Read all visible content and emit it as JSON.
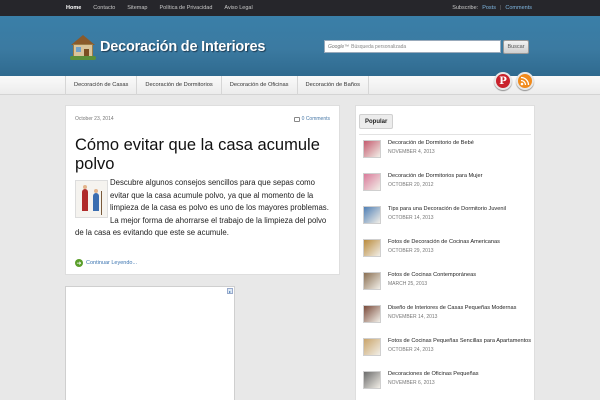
{
  "topbar": {
    "nav": [
      "Home",
      "Contacto",
      "Sitemap",
      "Política de Privacidad",
      "Aviso Legal"
    ],
    "subscribe_label": "Subscribe:",
    "subscribe_posts": "Posts",
    "subscribe_sep": "|",
    "subscribe_comments": "Comments"
  },
  "header": {
    "site_title": "Decoración de Interiores",
    "search_brand": "Google™",
    "search_placeholder": "Búsqueda personalizada",
    "search_button": "Buscar"
  },
  "categories": [
    "Decoración de Casas",
    "Decoración de Dormitorios",
    "Decoración de Oficinas",
    "Decoración de Baños"
  ],
  "social": {
    "pinterest_icon": "pinterest-icon",
    "rss_icon": "rss-icon"
  },
  "post": {
    "date": "October 23, 2014",
    "comments": "0 Comments",
    "title": "Cómo evitar que la casa acumule polvo",
    "excerpt": "Descubre algunos consejos sencillos para que sepas como evitar que la casa acumule polvo, ya que al momento de la limpieza de la casa es polvo es uno de los mayores problemas. La mejor forma de ahorrarse el trabajo de la limpieza del polvo de la casa es evitando que este se acumule.",
    "read_more": "Continuar Leyendo..."
  },
  "sidebar": {
    "tab": "Popular",
    "items": [
      {
        "title": "Decoración de Dormitorio de Bebé",
        "date": "NOVEMBER 4, 2013",
        "color": "#c45a6e"
      },
      {
        "title": "Decoración de Dormitorios para Mujer",
        "date": "OCTOBER 20, 2012",
        "color": "#d97a9a"
      },
      {
        "title": "Tips para una Decoración de Dormitorio Juvenil",
        "date": "OCTOBER 14, 2013",
        "color": "#4f7fb5"
      },
      {
        "title": "Fotos de Decoración de Cocinas Americanas",
        "date": "OCTOBER 29, 2013",
        "color": "#b98a3c"
      },
      {
        "title": "Fotos de Cocinas Contemporáneas",
        "date": "MARCH 25, 2013",
        "color": "#8a6f52"
      },
      {
        "title": "Diseño de Interiores de Casas Pequeñas Modernas",
        "date": "NOVEMBER 14, 2013",
        "color": "#7a4a3a"
      },
      {
        "title": "Fotos de Cocinas Pequeñas Sencillas para Apartamentos",
        "date": "OCTOBER 24, 2013",
        "color": "#c9a46a"
      },
      {
        "title": "Decoraciones de Oficinas Pequeñas",
        "date": "NOVEMBER 6, 2013",
        "color": "#6b6b6b"
      }
    ]
  }
}
